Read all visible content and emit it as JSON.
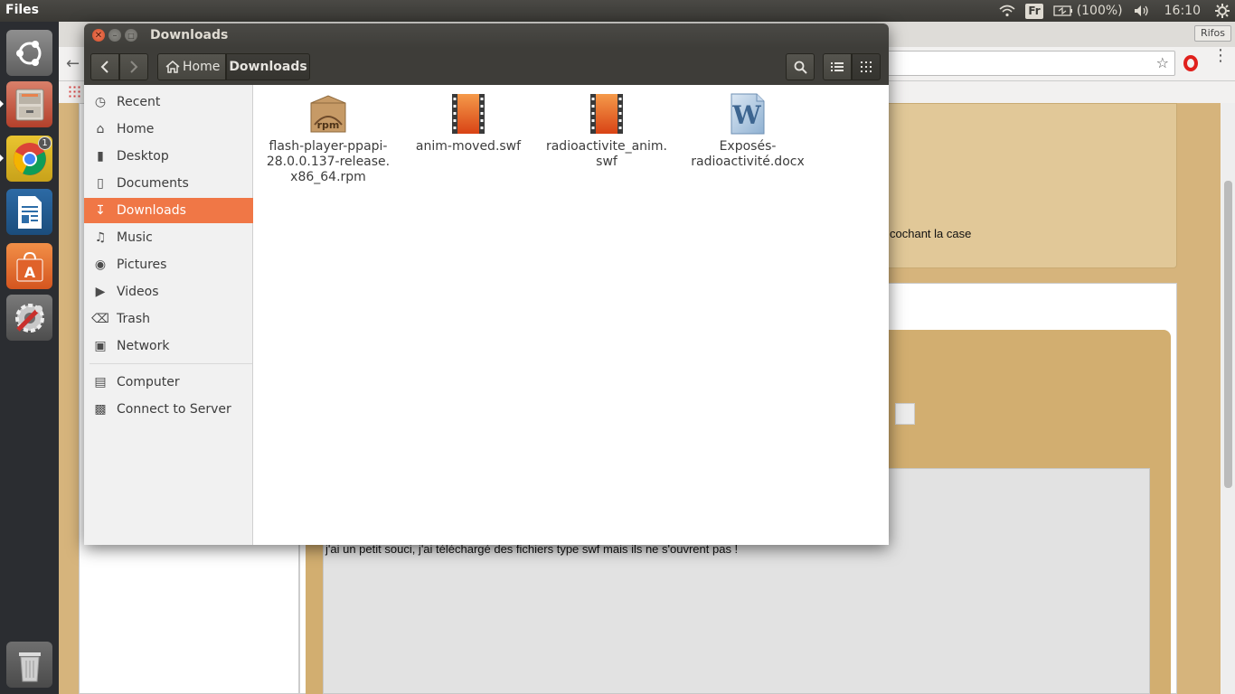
{
  "topbar": {
    "app_name": "Files",
    "keyboard_layout": "Fr",
    "battery": "(100%)",
    "time": "16:10"
  },
  "launcher": {
    "items": [
      "dash-home",
      "files",
      "chrome",
      "writer",
      "software-center",
      "system-settings"
    ],
    "chrome_badge": "1"
  },
  "browser": {
    "profile": "Rifos",
    "page_text_1": "cochant la case",
    "page_text_2": "j'ai un petit souci, j'ai téléchargé des fichiers type swf mais ils ne s'ouvrent pas !"
  },
  "window": {
    "title": "Downloads",
    "path": [
      "Home",
      "Downloads"
    ]
  },
  "sidebar": {
    "items": [
      {
        "label": "Recent",
        "icon": "clock-icon"
      },
      {
        "label": "Home",
        "icon": "home-icon"
      },
      {
        "label": "Desktop",
        "icon": "folder-icon"
      },
      {
        "label": "Documents",
        "icon": "document-icon"
      },
      {
        "label": "Downloads",
        "icon": "download-icon"
      },
      {
        "label": "Music",
        "icon": "music-icon"
      },
      {
        "label": "Pictures",
        "icon": "camera-icon"
      },
      {
        "label": "Videos",
        "icon": "film-icon"
      },
      {
        "label": "Trash",
        "icon": "trash-icon"
      },
      {
        "label": "Network",
        "icon": "network-icon"
      },
      {
        "label": "Computer",
        "icon": "computer-icon"
      },
      {
        "label": "Connect to Server",
        "icon": "server-icon"
      }
    ],
    "selected": "Downloads"
  },
  "files": [
    {
      "line1": "flash-player-ppapi-",
      "line2": "28.0.0.137-release.",
      "line3": "x86_64.rpm",
      "icon": "rpm-package-icon"
    },
    {
      "line1": "anim-moved.swf",
      "line2": "",
      "line3": "",
      "icon": "video-file-icon"
    },
    {
      "line1": "radioactivite_anim.",
      "line2": "swf",
      "line3": "",
      "icon": "video-file-icon"
    },
    {
      "line1": "Exposés-",
      "line2": "radioactivité.docx",
      "line3": "",
      "icon": "word-document-icon"
    }
  ],
  "colors": {
    "accent": "#f07746",
    "titlebar": "#3e3d39",
    "launcher": "#2b2d31",
    "page_bg": "#d6b47c"
  }
}
